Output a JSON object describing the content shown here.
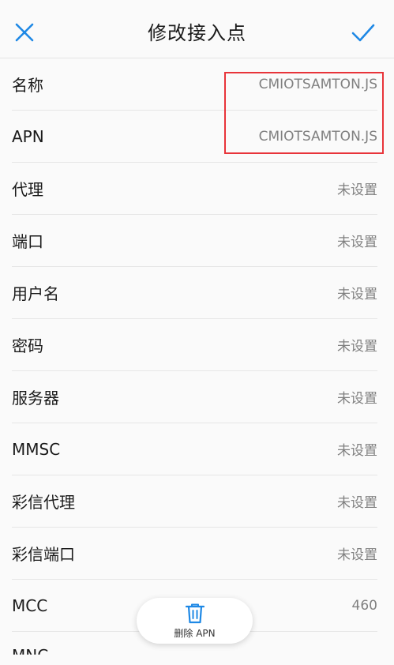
{
  "header": {
    "title": "修改接入点",
    "close_icon": "close-icon",
    "confirm_icon": "check-icon",
    "accent_color": "#1e88e5"
  },
  "settings": [
    {
      "label": "名称",
      "value": "CMIOTSAMTON.JS"
    },
    {
      "label": "APN",
      "value": "CMIOTSAMTON.JS"
    },
    {
      "label": "代理",
      "value": "未设置"
    },
    {
      "label": "端口",
      "value": "未设置"
    },
    {
      "label": "用户名",
      "value": "未设置"
    },
    {
      "label": "密码",
      "value": "未设置"
    },
    {
      "label": "服务器",
      "value": "未设置"
    },
    {
      "label": "MMSC",
      "value": "未设置"
    },
    {
      "label": "彩信代理",
      "value": "未设置"
    },
    {
      "label": "彩信端口",
      "value": "未设置"
    },
    {
      "label": "MCC",
      "value": "460"
    }
  ],
  "fab": {
    "label": "删除 APN",
    "icon": "trash-icon"
  },
  "partial_row_label": "MNC",
  "annotation_color": "#e8343a"
}
